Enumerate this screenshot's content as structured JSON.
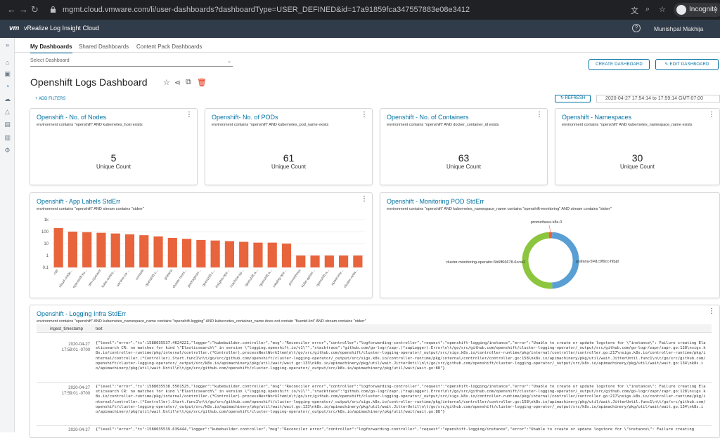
{
  "browser": {
    "url": "mgmt.cloud.vmware.com/li/user-dashboards?dashboardType=USER_DEFINED&id=17a91859fca347557883e08e3412",
    "incognito_label": "Incognito"
  },
  "app": {
    "logo": "vm",
    "title": "vRealize Log Insight Cloud",
    "user": "Munishpal Makhija",
    "help_icon": "help-circle-icon"
  },
  "tabs": [
    {
      "label": "My Dashboards",
      "active": true
    },
    {
      "label": "Shared Dashboards",
      "active": false
    },
    {
      "label": "Content Pack Dashboards",
      "active": false
    }
  ],
  "select_dashboard": {
    "placeholder": "Select Dashboard"
  },
  "buttons": {
    "create": "CREATE DASHBOARD",
    "edit": "EDIT DASHBOARD",
    "add_filters": "+ ADD FILTERS",
    "refresh": "REFRESH"
  },
  "dashboard_title": "Openshift Logs Dashboard",
  "time_range": {
    "start": "2020-04-27 17:54:14",
    "to": "to",
    "end": "17:59:14 GMT-07:00"
  },
  "count_cards": [
    {
      "title": "Openshift - No. of Nodes",
      "query": "environment contains \"openshift\" AND kubernetes_host exists",
      "value": "5",
      "label": "Unique Count"
    },
    {
      "title": "Openshift- No. of PODs",
      "query": "environment contains \"openshift\" AND kubernetes_pod_name exists",
      "value": "61",
      "label": "Unique Count"
    },
    {
      "title": "Openshift - No. of Containers",
      "query": "environment contains \"openshift\" AND docker_container_id exists",
      "value": "63",
      "label": "Unique Count"
    },
    {
      "title": "Openshift - Namespaces",
      "query": "environment contains \"openshift\" AND kubernetes_namespace_name exists",
      "value": "30",
      "label": "Unique Count"
    }
  ],
  "bar_card": {
    "title": "Openshift - App Labels StdErr",
    "query": "environment contains \"openshift\" AND stream contains \"stderr\""
  },
  "pie_card": {
    "title": "Openshift - Monitoring POD StdErr",
    "query": "environment contains \"openshift\" AND kubernetes_namespace_name contains \"openshift-monitoring\" AND stream contains \"stderr\""
  },
  "log_card": {
    "title": "Openshift - Logging Infra StdErr",
    "query": "environment contains \"openshift\" AND kubernetes_namespace_name contains \"openshift-logging\" AND kubernetes_container_name does not contain \"fluentd-lint\" AND stream contains \"stderr\"",
    "columns": [
      "ingest_timestamp",
      "text"
    ],
    "rows": [
      {
        "ts1": "2020-04-27",
        "ts2": "17:59:01 -0700",
        "text": "{\"level\":\"error\",\"ts\":1588035537.4624221,\"logger\":\"kubebuilder.controller\",\"msg\":\"Reconciler error\",\"controller\":\"logforwarding-controller\",\"request\":\"openshift-logging/instance\",\"error\":\"Unable to create or update logstore for \\\"instance\\\": Failure creating Elasticsearch CR: no matches for kind \\\"Elasticsearch\\\" in version \\\"logging.openshift.io/v1\\\"\",\"stacktrace\":\"github.com/go-logr/zapr.(*zapLogger).Error\\n\\t/go/src/github.com/openshift/cluster-logging-operator/_output/src/github.com/go-logr/zapr/zapr.go:128\\nsigs.k8s.io/controller-runtime/pkg/internal/controller.(*Controller).processNextWorkItem\\n\\t/go/src/github.com/openshift/cluster-logging-operator/_output/src/sigs.k8s.io/controller-runtime/pkg/internal/controller/controller.go:217\\nsigs.k8s.io/controller-runtime/pkg/internal/controller.(*Controller).Start.func1\\n\\t/go/src/github.com/openshift/cluster-logging-operator/_output/src/sigs.k8s.io/controller-runtime/pkg/internal/controller/controller.go:158\\nk8s.io/apimachinery/pkg/util/wait.JitterUntil.func1\\n\\t/go/src/github.com/openshift/cluster-logging-operator/_output/src/k8s.io/apimachinery/pkg/util/wait/wait.go:133\\nk8s.io/apimachinery/pkg/util/wait.JitterUntil\\n\\t/go/src/github.com/openshift/cluster-logging-operator/_output/src/k8s.io/apimachinery/pkg/util/wait/wait.go:134\\nk8s.io/apimachinery/pkg/util/wait.Until\\n\\t/go/src/github.com/openshift/cluster-logging-operator/_output/src/k8s.io/apimachinery/pkg/util/wait/wait.go:88\"}"
      },
      {
        "ts1": "2020-04-27",
        "ts2": "17:59:01 -0700",
        "text": "{\"level\":\"error\",\"ts\":1588035538.5501525,\"logger\":\"kubebuilder.controller\",\"msg\":\"Reconciler error\",\"controller\":\"logforwarding-controller\",\"request\":\"openshift-logging/instance\",\"error\":\"Unable to create or update logstore for \\\"instance\\\": Failure creating Elasticsearch CR: no matches for kind \\\"Elasticsearch\\\" in version \\\"logging.openshift.io/v1\\\"\",\"stacktrace\":\"github.com/go-logr/zapr.(*zapLogger).Error\\n\\t/go/src/github.com/openshift/cluster-logging-operator/_output/src/github.com/go-logr/zapr/zapr.go:128\\nsigs.k8s.io/controller-runtime/pkg/internal/controller.(*Controller).processNextWorkItem\\n\\t/go/src/github.com/openshift/cluster-logging-operator/_output/src/sigs.k8s.io/controller-runtime/pkg/internal/controller/controller.go:217\\nsigs.k8s.io/controller-runtime/pkg/internal/controller.(*Controller).Start.func1\\n\\t/go/src/github.com/openshift/cluster-logging-operator/_output/src/sigs.k8s.io/controller-runtime/pkg/internal/controller/controller.go:158\\nk8s.io/apimachinery/pkg/util/wait.JitterUntil.func1\\n\\t/go/src/github.com/openshift/cluster-logging-operator/_output/src/k8s.io/apimachinery/pkg/util/wait/wait.go:133\\nk8s.io/apimachinery/pkg/util/wait.JitterUntil\\n\\t/go/src/github.com/openshift/cluster-logging-operator/_output/src/k8s.io/apimachinery/pkg/util/wait/wait.go:134\\nk8s.io/apimachinery/pkg/util/wait.Until\\n\\t/go/src/github.com/openshift/cluster-logging-operator/_output/src/k8s.io/apimachinery/pkg/util/wait/wait.go:88\"}"
      },
      {
        "ts1": "2020-04-27",
        "ts2": "",
        "text": "{\"level\":\"error\",\"ts\":1588035539.639444,\"logger\":\"kubebuilder.controller\",\"msg\":\"Reconciler error\",\"controller\":\"logforwarding-controller\",\"request\":\"openshift-logging/instance\",\"error\":\"Unable to create or update logstore for \\\"instance\\\": Failure creating"
      }
    ]
  },
  "chart_data": [
    {
      "type": "bar",
      "title": "Openshift - App Labels StdErr",
      "yscale": "log",
      "yticks": [
        "1k",
        "100",
        "10",
        "1",
        "0.1"
      ],
      "ylim": [
        0.1,
        1000
      ],
      "categories": [
        "cdn",
        "cloud-crede...",
        "openshift-ku...",
        "olm-operator",
        "kube-contro...",
        "service-ca-...",
        "console",
        "openshift-c...",
        "grafana",
        "cluster-moni...",
        "packageser...",
        "openshift-c...",
        "insights-ope...",
        "machine-ap...",
        "openshift-a...",
        "openshift-a...",
        "catalog-ope...",
        "prometheus",
        "kube-apiser...",
        "openshift-a...",
        "apiservice...",
        "cluster-netw..."
      ],
      "values": [
        200,
        100,
        90,
        80,
        70,
        60,
        50,
        40,
        30,
        25,
        20,
        18,
        16,
        14,
        12,
        12,
        10,
        1,
        1,
        1,
        1,
        1
      ],
      "color": "#e8643c"
    },
    {
      "type": "pie",
      "title": "Openshift - Monitoring POD StdErr",
      "labels": [
        "grafana-5f41c9f9cc-hfpjd",
        "cluster-monitoring-operator-5b6ff66678-6ccw2",
        "prometheus-k8s-0"
      ],
      "values": [
        48,
        50,
        2
      ],
      "colors": [
        "#5a9fd4",
        "#8cc63f",
        "#e8643c"
      ],
      "donut": true
    }
  ]
}
